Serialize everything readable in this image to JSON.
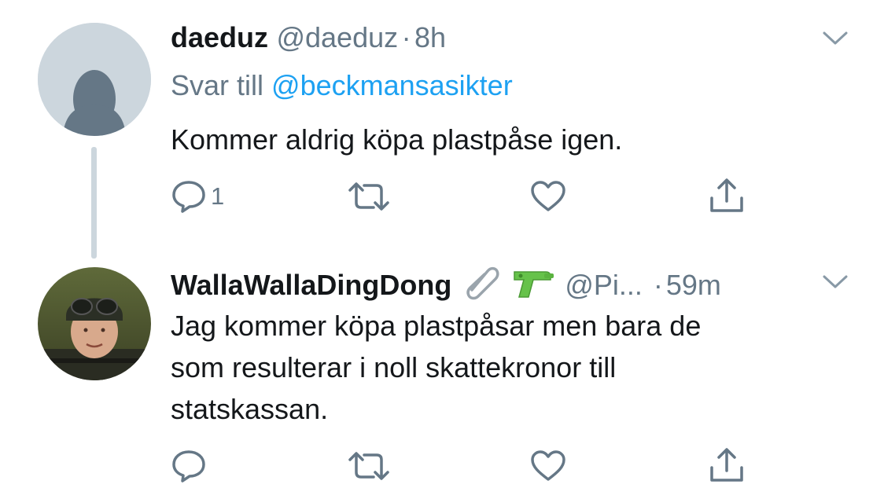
{
  "tweets": [
    {
      "name": "daeduz",
      "handle": "@daeduz",
      "separator": "·",
      "time": "8h",
      "reply_prefix": "Svar till ",
      "reply_handle": "@beckmansasikter",
      "text": "Kommer aldrig köpa plastpåse igen.",
      "reply_count": "1",
      "avatar_icon": "default-profile-icon"
    },
    {
      "name": "WallaWallaDingDong",
      "badges": [
        "paperclip-emoji",
        "water-pistol-emoji"
      ],
      "handle": "@Pi...",
      "separator": "·",
      "time": "59m",
      "text_lines": [
        "Jag kommer köpa plastpåsar men bara de",
        "som resulterar i noll skattekronor till",
        "statskassan."
      ],
      "reply_count": "",
      "avatar_icon": "profile-photo"
    }
  ],
  "colors": {
    "text": "#14171a",
    "secondary": "#657786",
    "link": "#1da1f2",
    "divider": "#ccd6dd"
  }
}
